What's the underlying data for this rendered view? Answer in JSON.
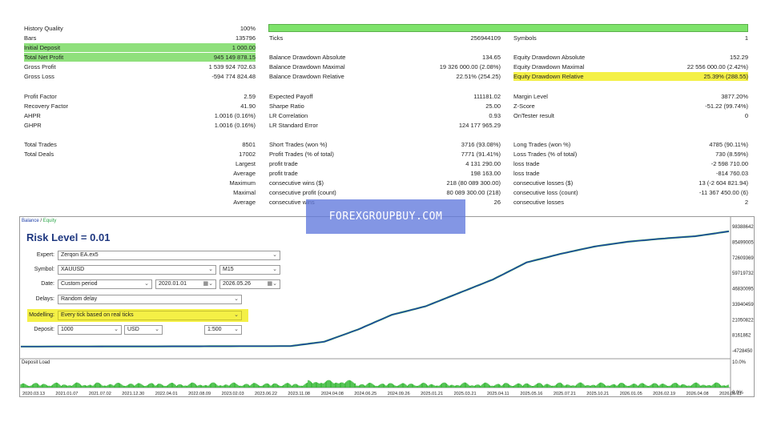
{
  "stats_col1": [
    {
      "label": "History Quality",
      "value": "100%"
    },
    {
      "label": "Bars",
      "value": "135796"
    },
    {
      "label": "Initial Deposit",
      "value": "1 000.00"
    },
    {
      "label": "Total Net Profit",
      "value": "945 149 878.15"
    },
    {
      "label": "Gross Profit",
      "value": "1 539 924 702.63"
    },
    {
      "label": "Gross Loss",
      "value": "-594 774 824.48"
    },
    {
      "label": "Profit Factor",
      "value": "2.59"
    },
    {
      "label": "Recovery Factor",
      "value": "41.90"
    },
    {
      "label": "AHPR",
      "value": "1.0016 (0.16%)"
    },
    {
      "label": "GHPR",
      "value": "1.0016 (0.16%)"
    },
    {
      "label": "Total Trades",
      "value": "8501"
    },
    {
      "label": "Total Deals",
      "value": "17002"
    },
    {
      "label": "Largest",
      "value": ""
    },
    {
      "label": "Average",
      "value": ""
    },
    {
      "label": "Maximum",
      "value": ""
    },
    {
      "label": "Maximal",
      "value": ""
    },
    {
      "label": "Average",
      "value": ""
    }
  ],
  "stats_col2": [
    {
      "label": "Ticks",
      "value": "256944109"
    },
    {
      "label": "Balance Drawdown Absolute",
      "value": "134.65"
    },
    {
      "label": "Balance Drawdown Maximal",
      "value": "19 326 000.00 (2.08%)"
    },
    {
      "label": "Balance Drawdown Relative",
      "value": "22.51% (254.25)"
    },
    {
      "label": "Expected Payoff",
      "value": "111181.02"
    },
    {
      "label": "Sharpe Ratio",
      "value": "25.00"
    },
    {
      "label": "LR Correlation",
      "value": "0.93"
    },
    {
      "label": "LR Standard Error",
      "value": "124 177 965.29"
    },
    {
      "label": "Short Trades (won %)",
      "value": "3716 (93.08%)"
    },
    {
      "label": "Profit Trades (% of total)",
      "value": "7771 (91.41%)"
    },
    {
      "label": "profit trade",
      "value": "4 131 290.00"
    },
    {
      "label": "profit trade",
      "value": "198 163.00"
    },
    {
      "label": "consecutive wins ($)",
      "value": "218 (80 089 300.00)"
    },
    {
      "label": "consecutive profit (count)",
      "value": "80 089 300.00 (218)"
    },
    {
      "label": "consecutive wins",
      "value": "26"
    }
  ],
  "stats_col3": [
    {
      "label": "Symbols",
      "value": "1"
    },
    {
      "label": "Equity Drawdown Absolute",
      "value": "152.29"
    },
    {
      "label": "Equity Drawdown Maximal",
      "value": "22 556 000.00 (2.42%)"
    },
    {
      "label": "Equity Drawdown Relative",
      "value": "25.39% (288.55)"
    },
    {
      "label": "Margin Level",
      "value": "3877.20%"
    },
    {
      "label": "Z-Score",
      "value": "-51.22 (99.74%)"
    },
    {
      "label": "OnTester result",
      "value": "0"
    },
    {
      "label": "Long Trades (won %)",
      "value": "4785 (90.11%)"
    },
    {
      "label": "Loss Trades (% of total)",
      "value": "730 (8.59%)"
    },
    {
      "label": "loss trade",
      "value": "-2 598 710.00"
    },
    {
      "label": "loss trade",
      "value": "-814 760.03"
    },
    {
      "label": "consecutive losses ($)",
      "value": "13 (-2 604 821.94)"
    },
    {
      "label": "consecutive loss (count)",
      "value": "-11 367 450.00 (6)"
    },
    {
      "label": "consecutive losses",
      "value": "2"
    }
  ],
  "chart_header": {
    "balance": "Balance",
    "sep": " / ",
    "equity": "Equity"
  },
  "risk_title": "Risk Level = 0.01",
  "settings": {
    "expert_label": "Expert:",
    "expert_value": "Zerqon EA.ex5",
    "symbol_label": "Symbol:",
    "symbol_value": "XAUUSD",
    "timeframe_value": "M15",
    "date_label": "Date:",
    "date_mode": "Custom period",
    "date_from": "2020.01.01",
    "date_to": "2026.05.26",
    "delays_label": "Delays:",
    "delays_value": "Random delay",
    "modelling_label": "Modelling:",
    "modelling_value": "Every tick based on real ticks",
    "deposit_label": "Deposit:",
    "deposit_value": "1000",
    "currency_value": "USD",
    "leverage_value": "1:500"
  },
  "watermark": "FOREXGROUPBUY.COM",
  "deposit_load_label": "Deposit Load",
  "colors": {
    "balance": "#1f3fa8",
    "equity": "#2ea84a",
    "load": "#2db52d",
    "highlight_green": "#8fe07c",
    "highlight_yellow": "#f4f046"
  },
  "chart_data": {
    "type": "line",
    "y_ticks": [
      "98388642",
      "85499005",
      "72609369",
      "59719732",
      "46830095",
      "33940459",
      "21050822",
      "8161862",
      "-4728450"
    ],
    "load_ticks": [
      "10.0%",
      "0.0%"
    ],
    "x_ticks": [
      "2020.03.13",
      "2021.01.07",
      "2021.07.02",
      "2021.12.30",
      "2022.04.01",
      "2022.08.09",
      "2023.02.03",
      "2023.06.22",
      "2023.11.08",
      "2024.04.08",
      "2024.06.25",
      "2024.09.26",
      "2025.01.21",
      "2025.03.21",
      "2025.04.11",
      "2025.05.16",
      "2025.07.21",
      "2025.10.21",
      "2026.01.05",
      "2026.02.19",
      "2026.04.08",
      "2026.05.11"
    ],
    "series": [
      {
        "name": "Balance",
        "points": [
          [
            0,
            1000
          ],
          [
            5,
            200000
          ],
          [
            8,
            400000
          ],
          [
            9,
            4000000
          ],
          [
            10,
            14000000
          ],
          [
            11,
            26000000
          ],
          [
            12,
            33000000
          ],
          [
            13,
            44000000
          ],
          [
            14,
            55000000
          ],
          [
            15,
            69000000
          ],
          [
            16,
            76000000
          ],
          [
            17,
            82000000
          ],
          [
            18,
            86000000
          ],
          [
            19,
            88500000
          ],
          [
            20,
            90500000
          ],
          [
            21,
            94500000
          ]
        ]
      }
    ]
  }
}
